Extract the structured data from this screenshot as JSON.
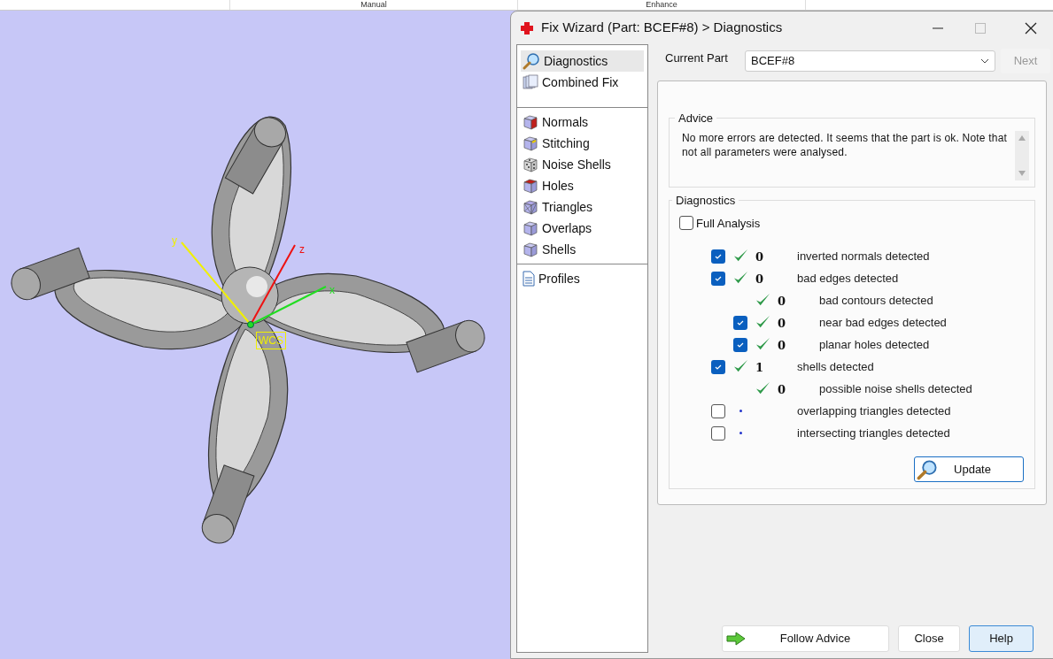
{
  "top_bar": {
    "columns": [
      "Manual",
      "Enhance"
    ]
  },
  "viewport": {
    "axes": [
      {
        "kind": "x",
        "label": "x"
      },
      {
        "kind": "y",
        "label": "y"
      },
      {
        "kind": "z",
        "label": "z"
      }
    ],
    "origin_label": "WCS"
  },
  "dialog": {
    "title": "Fix Wizard (Part: BCEF#8) > Diagnostics",
    "sidebar": {
      "sections": [
        [
          {
            "label": "Diagnostics",
            "kind": "magnifier",
            "selected": true
          },
          {
            "label": "Combined Fix",
            "kind": "pages",
            "selected": false
          }
        ],
        [
          {
            "label": "Normals",
            "kind": "normals",
            "selected": false
          },
          {
            "label": "Stitching",
            "kind": "stitching",
            "selected": false
          },
          {
            "label": "Noise Shells",
            "kind": "noise",
            "selected": false
          },
          {
            "label": "Holes",
            "kind": "holes",
            "selected": false
          },
          {
            "label": "Triangles",
            "kind": "triangles",
            "selected": false
          },
          {
            "label": "Overlaps",
            "kind": "cube",
            "selected": false
          },
          {
            "label": "Shells",
            "kind": "cube",
            "selected": false
          }
        ],
        [
          {
            "label": "Profiles",
            "kind": "document",
            "selected": false
          }
        ]
      ]
    },
    "current_part": {
      "label": "Current Part",
      "value": "BCEF#8"
    },
    "next_button": {
      "label": "Next",
      "disabled": true
    },
    "advice": {
      "title": "Advice",
      "text": "No more errors are detected. It seems that the part is ok. Note that not all parameters were analysed."
    },
    "diagnostics": {
      "title": "Diagnostics",
      "full_analysis": {
        "label": "Full Analysis",
        "checked": false
      },
      "rows": [
        {
          "kind": "checkbox",
          "checked": true,
          "ok": true,
          "count": "0",
          "label": "inverted normals detected"
        },
        {
          "kind": "checkbox",
          "checked": true,
          "ok": true,
          "count": "0",
          "label": "bad edges detected",
          "children": [
            {
              "kind": "plain",
              "ok": true,
              "count": "0",
              "label": "bad contours detected"
            },
            {
              "kind": "checkbox",
              "checked": true,
              "ok": true,
              "count": "0",
              "label": "near bad edges detected"
            },
            {
              "kind": "checkbox",
              "checked": true,
              "ok": true,
              "count": "0",
              "label": "planar holes detected"
            }
          ]
        },
        {
          "kind": "checkbox",
          "checked": true,
          "ok": true,
          "count": "1",
          "label": "shells detected",
          "children": [
            {
              "kind": "plain",
              "ok": true,
              "count": "0",
              "label": "possible noise shells detected"
            }
          ]
        },
        {
          "kind": "checkbox",
          "checked": false,
          "ok": false,
          "label": "overlapping triangles detected"
        },
        {
          "kind": "checkbox",
          "checked": false,
          "ok": false,
          "label": "intersecting triangles detected"
        }
      ],
      "update_button": "Update"
    },
    "buttons": [
      {
        "kind": "follow",
        "label": "Follow Advice"
      },
      {
        "kind": "plain",
        "label": "Close"
      },
      {
        "kind": "default",
        "label": "Help"
      }
    ]
  }
}
